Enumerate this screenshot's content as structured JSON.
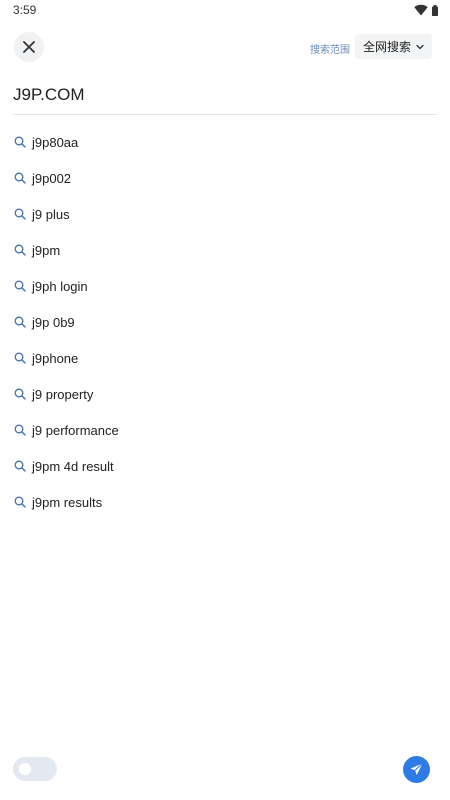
{
  "status_bar": {
    "time": "3:59",
    "icons": [
      "wifi-icon",
      "battery-icon"
    ]
  },
  "header": {
    "close_icon": "close-icon",
    "scope_label": "搜索范围",
    "scope_value": "全网搜索",
    "scope_chevron_icon": "chevron-down-icon"
  },
  "search": {
    "value": "J9P.COM",
    "placeholder": ""
  },
  "suggestions": [
    {
      "label": "j9p80aa",
      "icon": "search-icon"
    },
    {
      "label": "j9p002",
      "icon": "search-icon"
    },
    {
      "label": "j9 plus",
      "icon": "search-icon"
    },
    {
      "label": "j9pm",
      "icon": "search-icon"
    },
    {
      "label": "j9ph login",
      "icon": "search-icon"
    },
    {
      "label": "j9p 0b9",
      "icon": "search-icon"
    },
    {
      "label": "j9phone",
      "icon": "search-icon"
    },
    {
      "label": "j9 property",
      "icon": "search-icon"
    },
    {
      "label": "j9 performance",
      "icon": "search-icon"
    },
    {
      "label": "j9pm 4d result",
      "icon": "search-icon"
    },
    {
      "label": "j9pm results",
      "icon": "search-icon"
    }
  ],
  "footer": {
    "toggle_on": false,
    "send_icon": "send-icon"
  },
  "colors": {
    "accent": "#2f7be6",
    "scope_label": "#6b8bb8",
    "search_icon": "#3f6fb3",
    "text": "#222222"
  }
}
